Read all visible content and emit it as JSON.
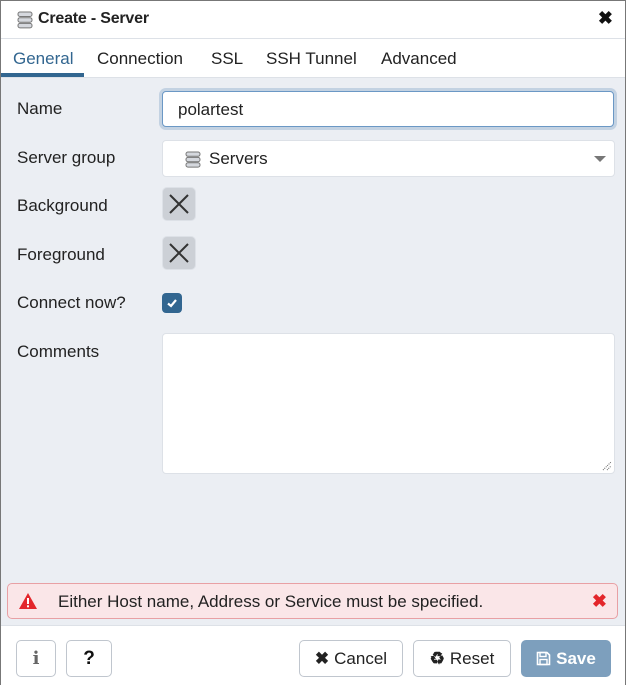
{
  "dialog": {
    "title": "Create - Server",
    "title_icon": "server-icon",
    "close_icon": "close-icon"
  },
  "tabs": [
    {
      "label": "General",
      "active": true
    },
    {
      "label": "Connection",
      "active": false
    },
    {
      "label": "SSL",
      "active": false
    },
    {
      "label": "SSH Tunnel",
      "active": false
    },
    {
      "label": "Advanced",
      "active": false
    }
  ],
  "form": {
    "name": {
      "label": "Name",
      "value": "polartest"
    },
    "server_group": {
      "label": "Server group",
      "value": "Servers",
      "icon": "server-group-icon"
    },
    "background": {
      "label": "Background",
      "value": "none"
    },
    "foreground": {
      "label": "Foreground",
      "value": "none"
    },
    "connect_now": {
      "label": "Connect now?",
      "checked": true
    },
    "comments": {
      "label": "Comments",
      "value": ""
    }
  },
  "alert": {
    "message": "Either Host name, Address or Service must be specified.",
    "icon": "warning-icon",
    "color": "#e3262b"
  },
  "footer": {
    "info_label": "i",
    "help_label": "?",
    "cancel_label": "Cancel",
    "reset_label": "Reset",
    "save_label": "Save"
  },
  "colors": {
    "accent": "#326690",
    "save_disabled": "#7d9fbd",
    "background": "#ebeef3"
  }
}
